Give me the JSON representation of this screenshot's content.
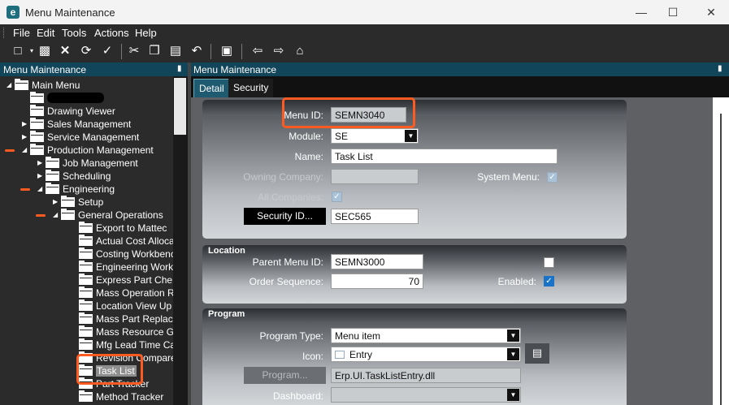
{
  "window": {
    "logo": "e",
    "title": "Menu Maintenance",
    "controls": {
      "minimize": "—",
      "maximize": "☐",
      "close": "✕"
    }
  },
  "menubar": [
    "File",
    "Edit",
    "Tools",
    "Actions",
    "Help"
  ],
  "toolbar_icons": [
    "new-icon",
    "save-icon",
    "delete-icon",
    "refresh-icon",
    "clear-icon",
    "cut-icon",
    "copy-icon",
    "paste-icon",
    "undo-icon",
    "search-icon",
    "back-icon",
    "forward-icon",
    "home-icon"
  ],
  "left_pane": {
    "title": "Menu Maintenance",
    "tree": [
      {
        "label": "Main Menu"
      },
      {
        "label": ""
      },
      {
        "label": "Drawing Viewer"
      },
      {
        "label": "Sales Management"
      },
      {
        "label": "Service Management"
      },
      {
        "label": "Production Management"
      },
      {
        "label": "Job Management"
      },
      {
        "label": "Scheduling"
      },
      {
        "label": "Engineering"
      },
      {
        "label": "Setup"
      },
      {
        "label": "General Operations"
      },
      {
        "label": "Export to Mattec"
      },
      {
        "label": "Actual Cost Alloca"
      },
      {
        "label": "Costing Workbenc"
      },
      {
        "label": "Engineering Work"
      },
      {
        "label": "Express Part Che"
      },
      {
        "label": "Mass Operation R"
      },
      {
        "label": "Location View Up"
      },
      {
        "label": "Mass Part Replac"
      },
      {
        "label": "Mass Resource G"
      },
      {
        "label": "Mfg Lead Time Ca"
      },
      {
        "label": "Revision Compare"
      },
      {
        "label": "Task List"
      },
      {
        "label": "Part Tracker"
      },
      {
        "label": "Method Tracker"
      }
    ]
  },
  "right_pane": {
    "title": "Menu Maintenance",
    "tabs": [
      {
        "label": "Detail"
      },
      {
        "label": "Security"
      }
    ],
    "detail": {
      "menu_id_label": "Menu ID:",
      "menu_id": "SEMN3040",
      "module_label": "Module:",
      "module": "SE",
      "name_label": "Name:",
      "name": "Task List",
      "owning_company_label": "Owning Company:",
      "owning_company": "",
      "system_menu_label": "System Menu:",
      "system_menu_checked": true,
      "all_companies_label": "All Companies:",
      "all_companies_checked": true,
      "security_id_button": "Security ID...",
      "security_id": "SEC565"
    },
    "location": {
      "title": "Location",
      "parent_menu_id_label": "Parent Menu ID:",
      "parent_menu_id": "SEMN3000",
      "order_sequence_label": "Order Sequence:",
      "order_sequence": "70",
      "enabled_label": "Enabled:",
      "enabled_checked": true,
      "extra_checkbox_checked": false
    },
    "program": {
      "title": "Program",
      "program_type_label": "Program Type:",
      "program_type": "Menu item",
      "icon_label": "Icon:",
      "icon_value": "Entry",
      "program_button": "Program...",
      "program_value": "Erp.UI.TaskListEntry.dll",
      "dashboard_label": "Dashboard:",
      "dashboard": ""
    }
  },
  "colors": {
    "header_bar": "#11455a",
    "highlight": "#ff5a1f",
    "checkbox_on": "#1a73c6"
  }
}
